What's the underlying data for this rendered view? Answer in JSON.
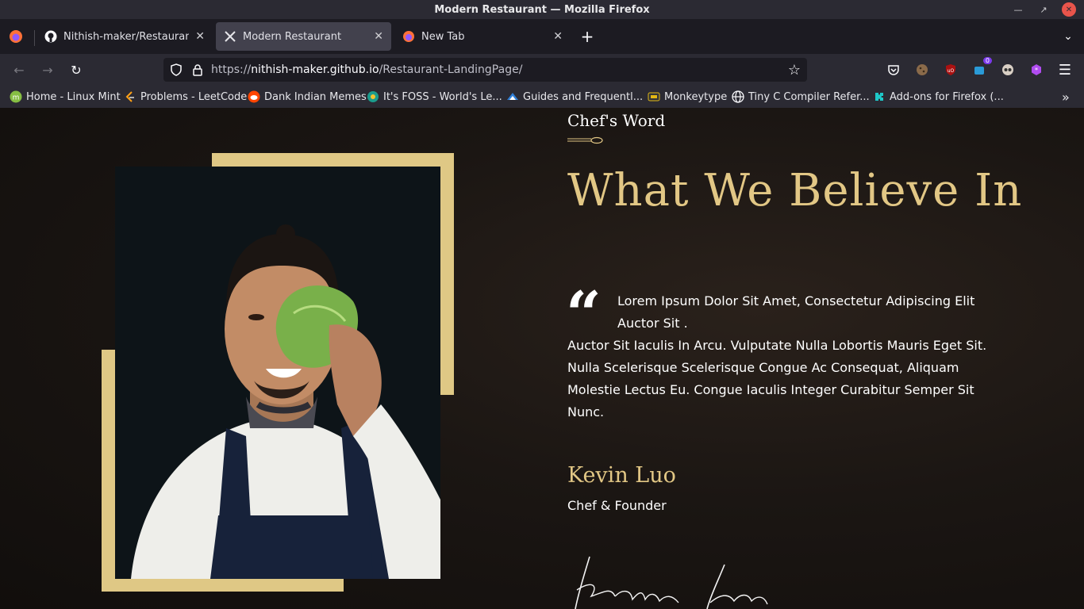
{
  "window": {
    "title": "Modern Restaurant — Mozilla Firefox"
  },
  "tabs": [
    {
      "label": "Nithish-maker/Restaurant-L",
      "icon": "github-icon"
    },
    {
      "label": "Modern Restaurant",
      "icon": "crossed-utensils-icon"
    },
    {
      "label": "New Tab",
      "icon": "firefox-icon"
    }
  ],
  "navbar": {
    "url_prefix": "https://",
    "url_host": "nithish-maker.github.io",
    "url_path": "/Restaurant-LandingPage/",
    "extension_badge": "0"
  },
  "bookmarks": [
    {
      "label": "Home - Linux Mint",
      "icon": "linux-mint-icon"
    },
    {
      "label": "Problems - LeetCode",
      "icon": "leetcode-icon"
    },
    {
      "label": "Dank Indian Memes",
      "icon": "reddit-icon"
    },
    {
      "label": "It's FOSS - World's Le...",
      "icon": "itsfoss-icon"
    },
    {
      "label": "Guides and Frequentl...",
      "icon": "guides-icon"
    },
    {
      "label": "Monkeytype",
      "icon": "monkeytype-icon"
    },
    {
      "label": "Tiny C Compiler Refer...",
      "icon": "globe-icon"
    },
    {
      "label": "Add-ons for Firefox (...",
      "icon": "addons-icon"
    }
  ],
  "content": {
    "subtitle": "Chef's Word",
    "headline": "What We Believe In",
    "quote_first": "Lorem Ipsum Dolor Sit Amet, Consectetur Adipiscing Elit Auctor Sit .",
    "quote_rest": "Auctor Sit Iaculis In Arcu. Vulputate Nulla Lobortis Mauris Eget Sit. Nulla Scelerisque Scelerisque Congue Ac Consequat, Aliquam Molestie Lectus Eu. Congue Iaculis Integer Curabitur Semper Sit Nunc.",
    "chef_name": "Kevin Luo",
    "chef_role": "Chef & Founder",
    "signature": "Kevin Luo"
  },
  "colors": {
    "accent_gold": "#e2c785",
    "frame_gold": "#dfc885",
    "page_bg": "#15110f",
    "chrome_bg": "#2b2a33"
  }
}
